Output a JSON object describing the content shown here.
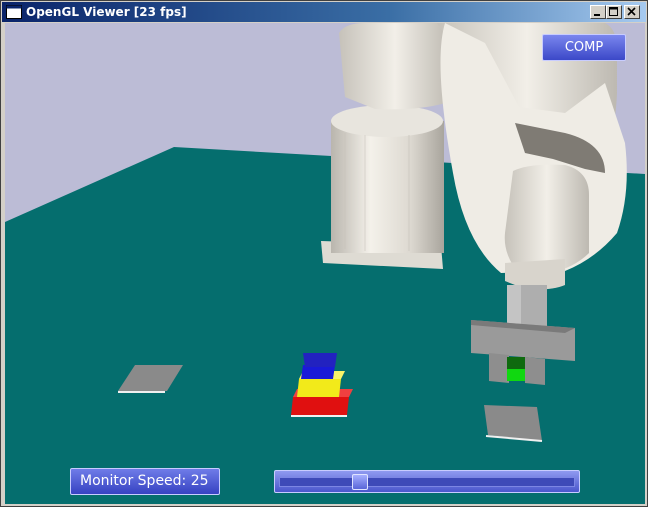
{
  "window": {
    "title": "OpenGL Viewer [23 fps]"
  },
  "controls": {
    "comp_button": "COMP",
    "monitor_speed_label": "Monitor Speed: 25",
    "monitor_speed_value": 25,
    "slider_fraction": 0.26
  },
  "colors": {
    "background": "#bcbcd6",
    "table": "#056e6e",
    "robot": "#ece9e2",
    "block_blue": "#1a1ad8",
    "block_yellow": "#f2ea1a",
    "block_red": "#e01010",
    "block_green": "#10d810",
    "pad": "#8a8a8a",
    "button_blue": "#4b58d6"
  },
  "icons": {
    "minimize": "minimize-icon",
    "maximize": "maximize-icon",
    "close": "close-icon",
    "app": "window-app-icon"
  }
}
